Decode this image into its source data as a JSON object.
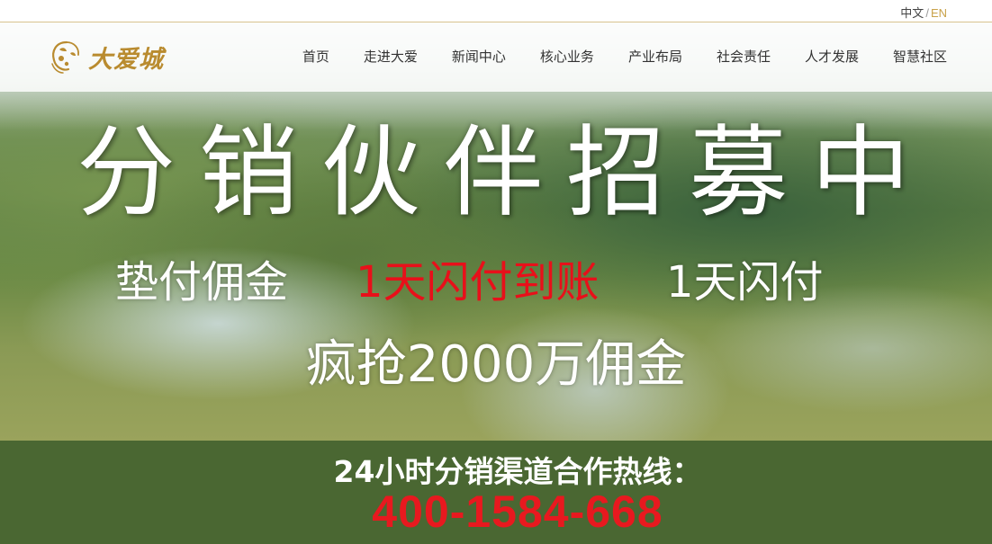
{
  "language": {
    "zh": "中文",
    "separator": "/",
    "en": "EN"
  },
  "logo": {
    "text": "大爱城",
    "icon": "logo-emblem-icon"
  },
  "nav": {
    "items": [
      {
        "label": "首页"
      },
      {
        "label": "走进大爱"
      },
      {
        "label": "新闻中心"
      },
      {
        "label": "核心业务"
      },
      {
        "label": "产业布局"
      },
      {
        "label": "社会责任"
      },
      {
        "label": "人才发展"
      },
      {
        "label": "智慧社区"
      }
    ]
  },
  "hero": {
    "headline": "分销伙伴招募中",
    "sub1": {
      "a": "垫付佣金",
      "b": "1天闪付到账",
      "c": "1天闪付"
    },
    "sub2": "疯抢2000万佣金"
  },
  "hotline": {
    "label": "24小时分销渠道合作热线：",
    "phone": "400-1584-668"
  },
  "colors": {
    "brand_gold": "#b98b2f",
    "band_green": "#4a6732",
    "accent_red": "#e8191f"
  }
}
